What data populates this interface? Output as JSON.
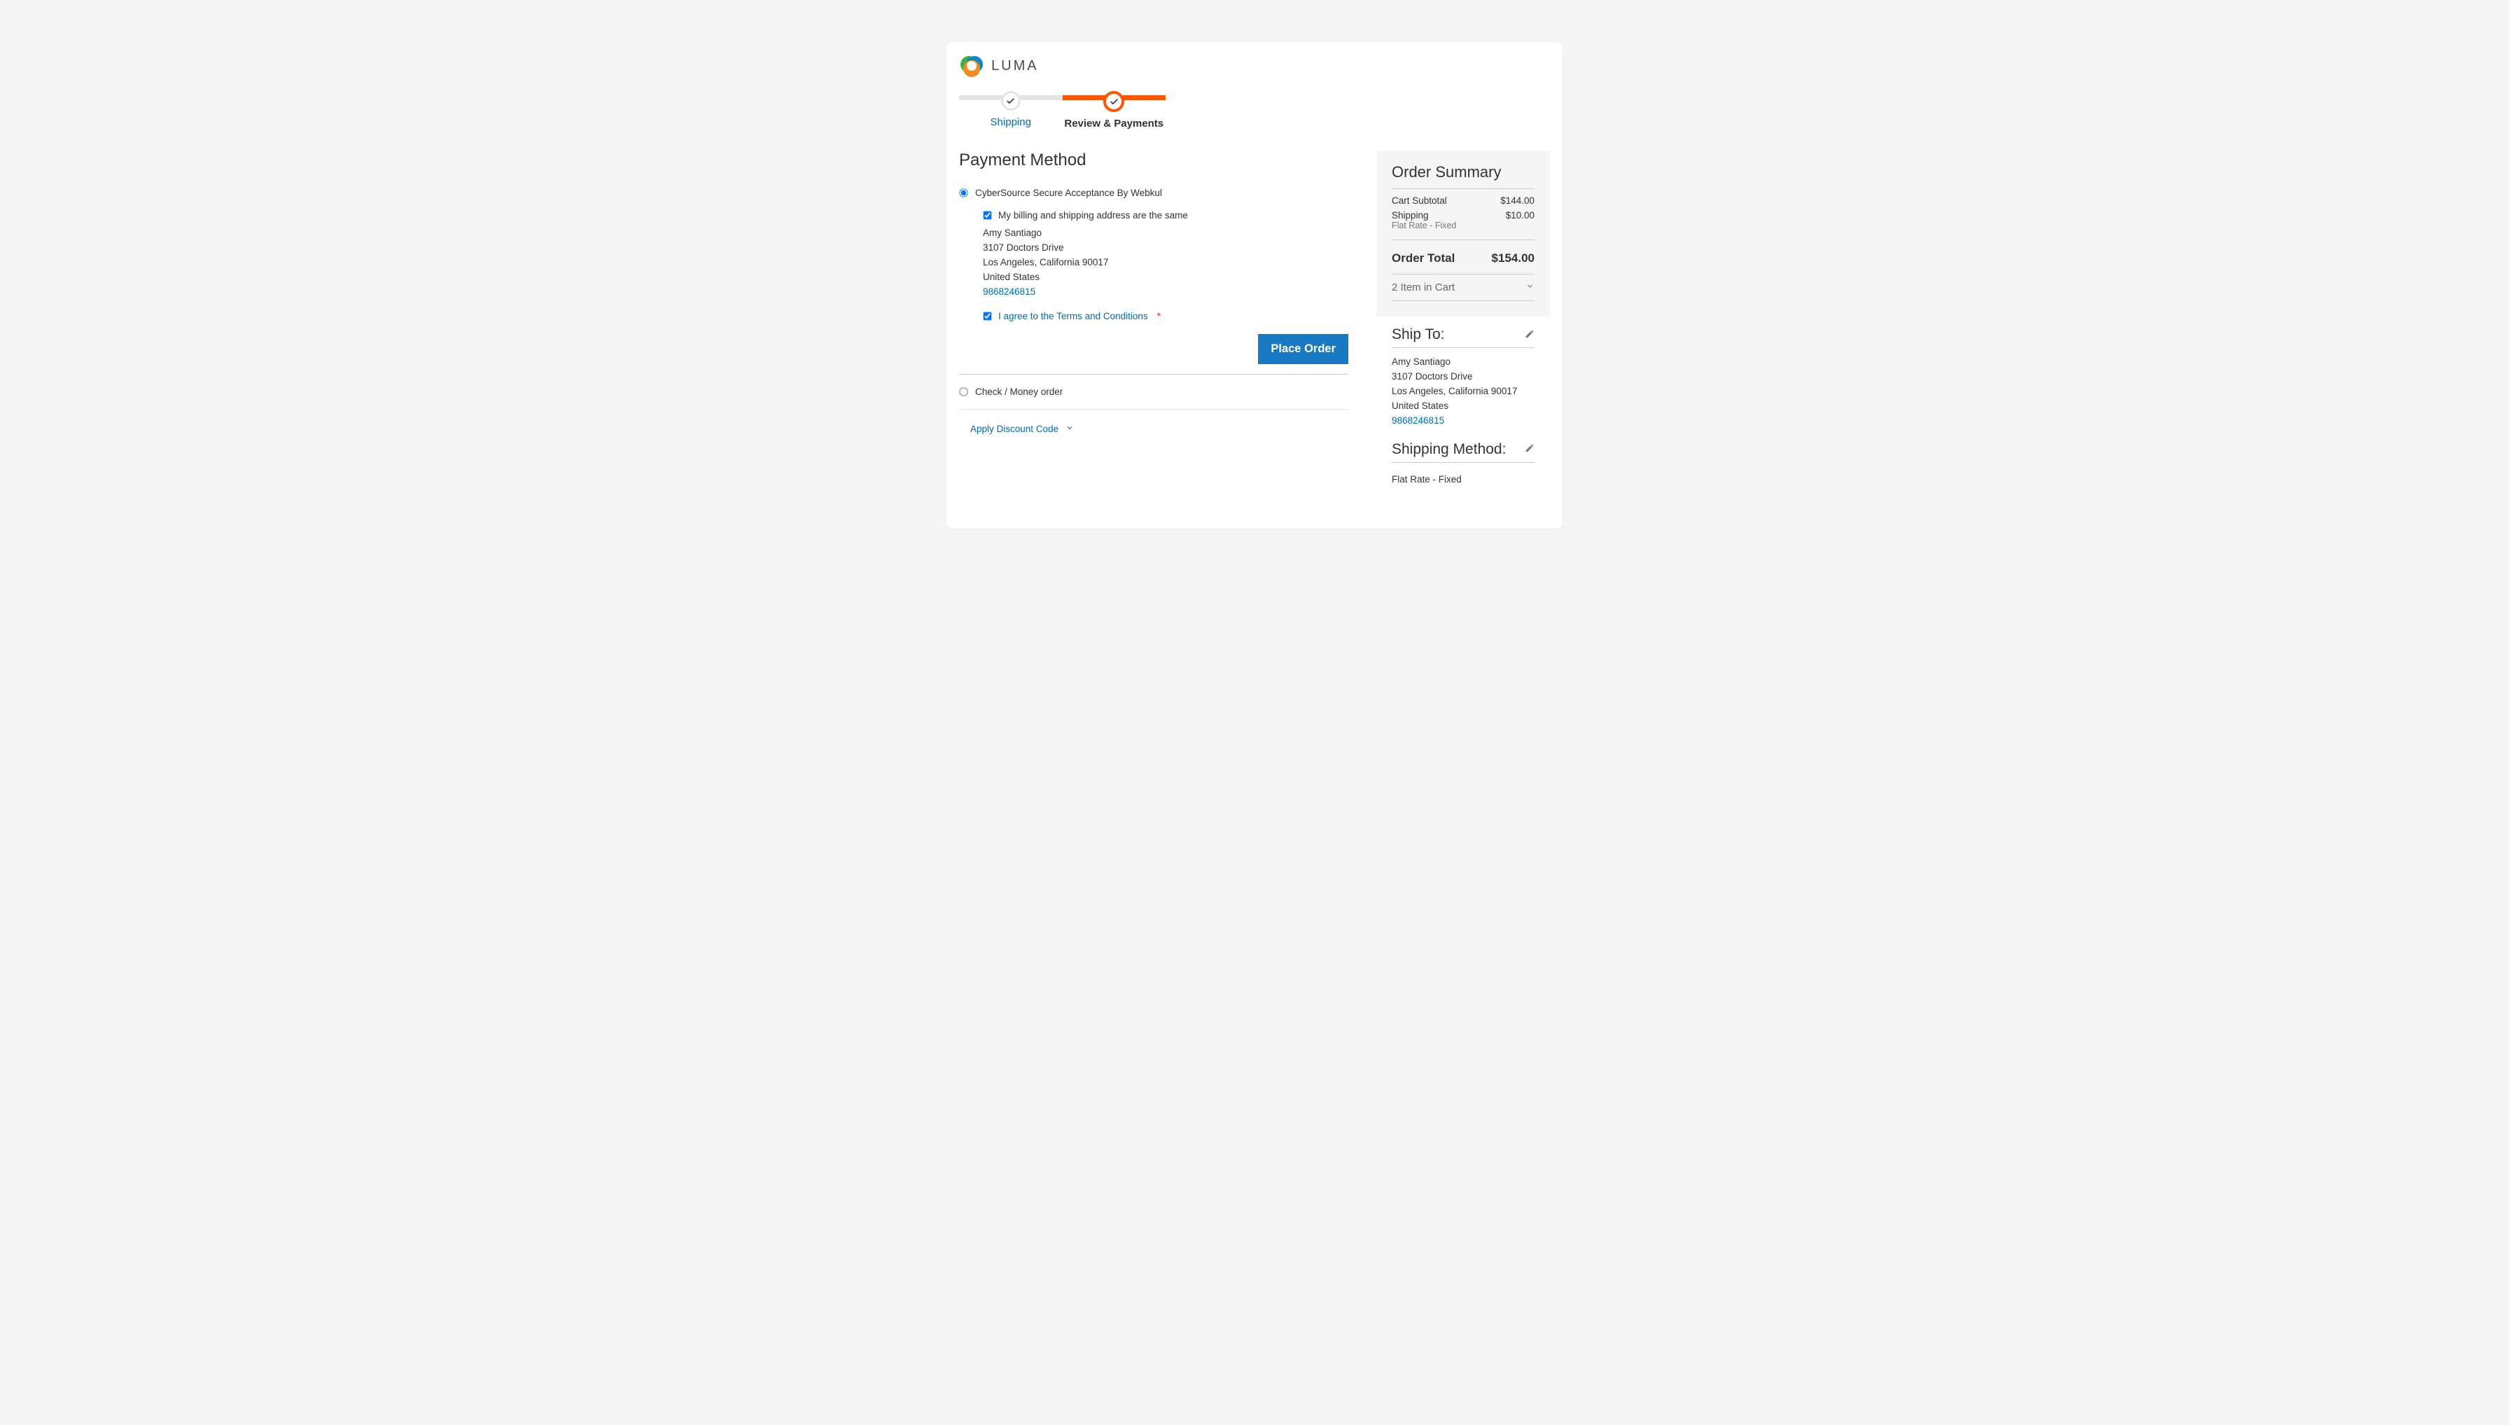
{
  "brand": "LUMA",
  "progress": {
    "step1_label": "Shipping",
    "step2_label": "Review & Payments"
  },
  "payment": {
    "title": "Payment Method",
    "option1": "CyberSource Secure Acceptance By Webkul",
    "billing_same_label": "My billing and shipping address are the same",
    "address": {
      "name": "Amy Santiago",
      "street": "3107 Doctors Drive",
      "city_line": "Los Angeles, California 90017",
      "country": "United States",
      "phone": "9868246815"
    },
    "tc_label": "I agree to the Terms and Conditions",
    "place_order": "Place Order",
    "option2": "Check / Money order",
    "discount": "Apply Discount Code"
  },
  "summary": {
    "title": "Order Summary",
    "subtotal_label": "Cart Subtotal",
    "subtotal_value": "$144.00",
    "shipping_label": "Shipping",
    "shipping_sub": "Flat Rate - Fixed",
    "shipping_value": "$10.00",
    "total_label": "Order Total",
    "total_value": "$154.00",
    "items_label": "2 Item in Cart"
  },
  "shipto": {
    "title": "Ship To:",
    "address": {
      "name": "Amy Santiago",
      "street": "3107 Doctors Drive",
      "city_line": "Los Angeles, California 90017",
      "country": "United States",
      "phone": "9868246815"
    }
  },
  "shipmethod": {
    "title": "Shipping Method:",
    "value": "Flat Rate - Fixed"
  }
}
